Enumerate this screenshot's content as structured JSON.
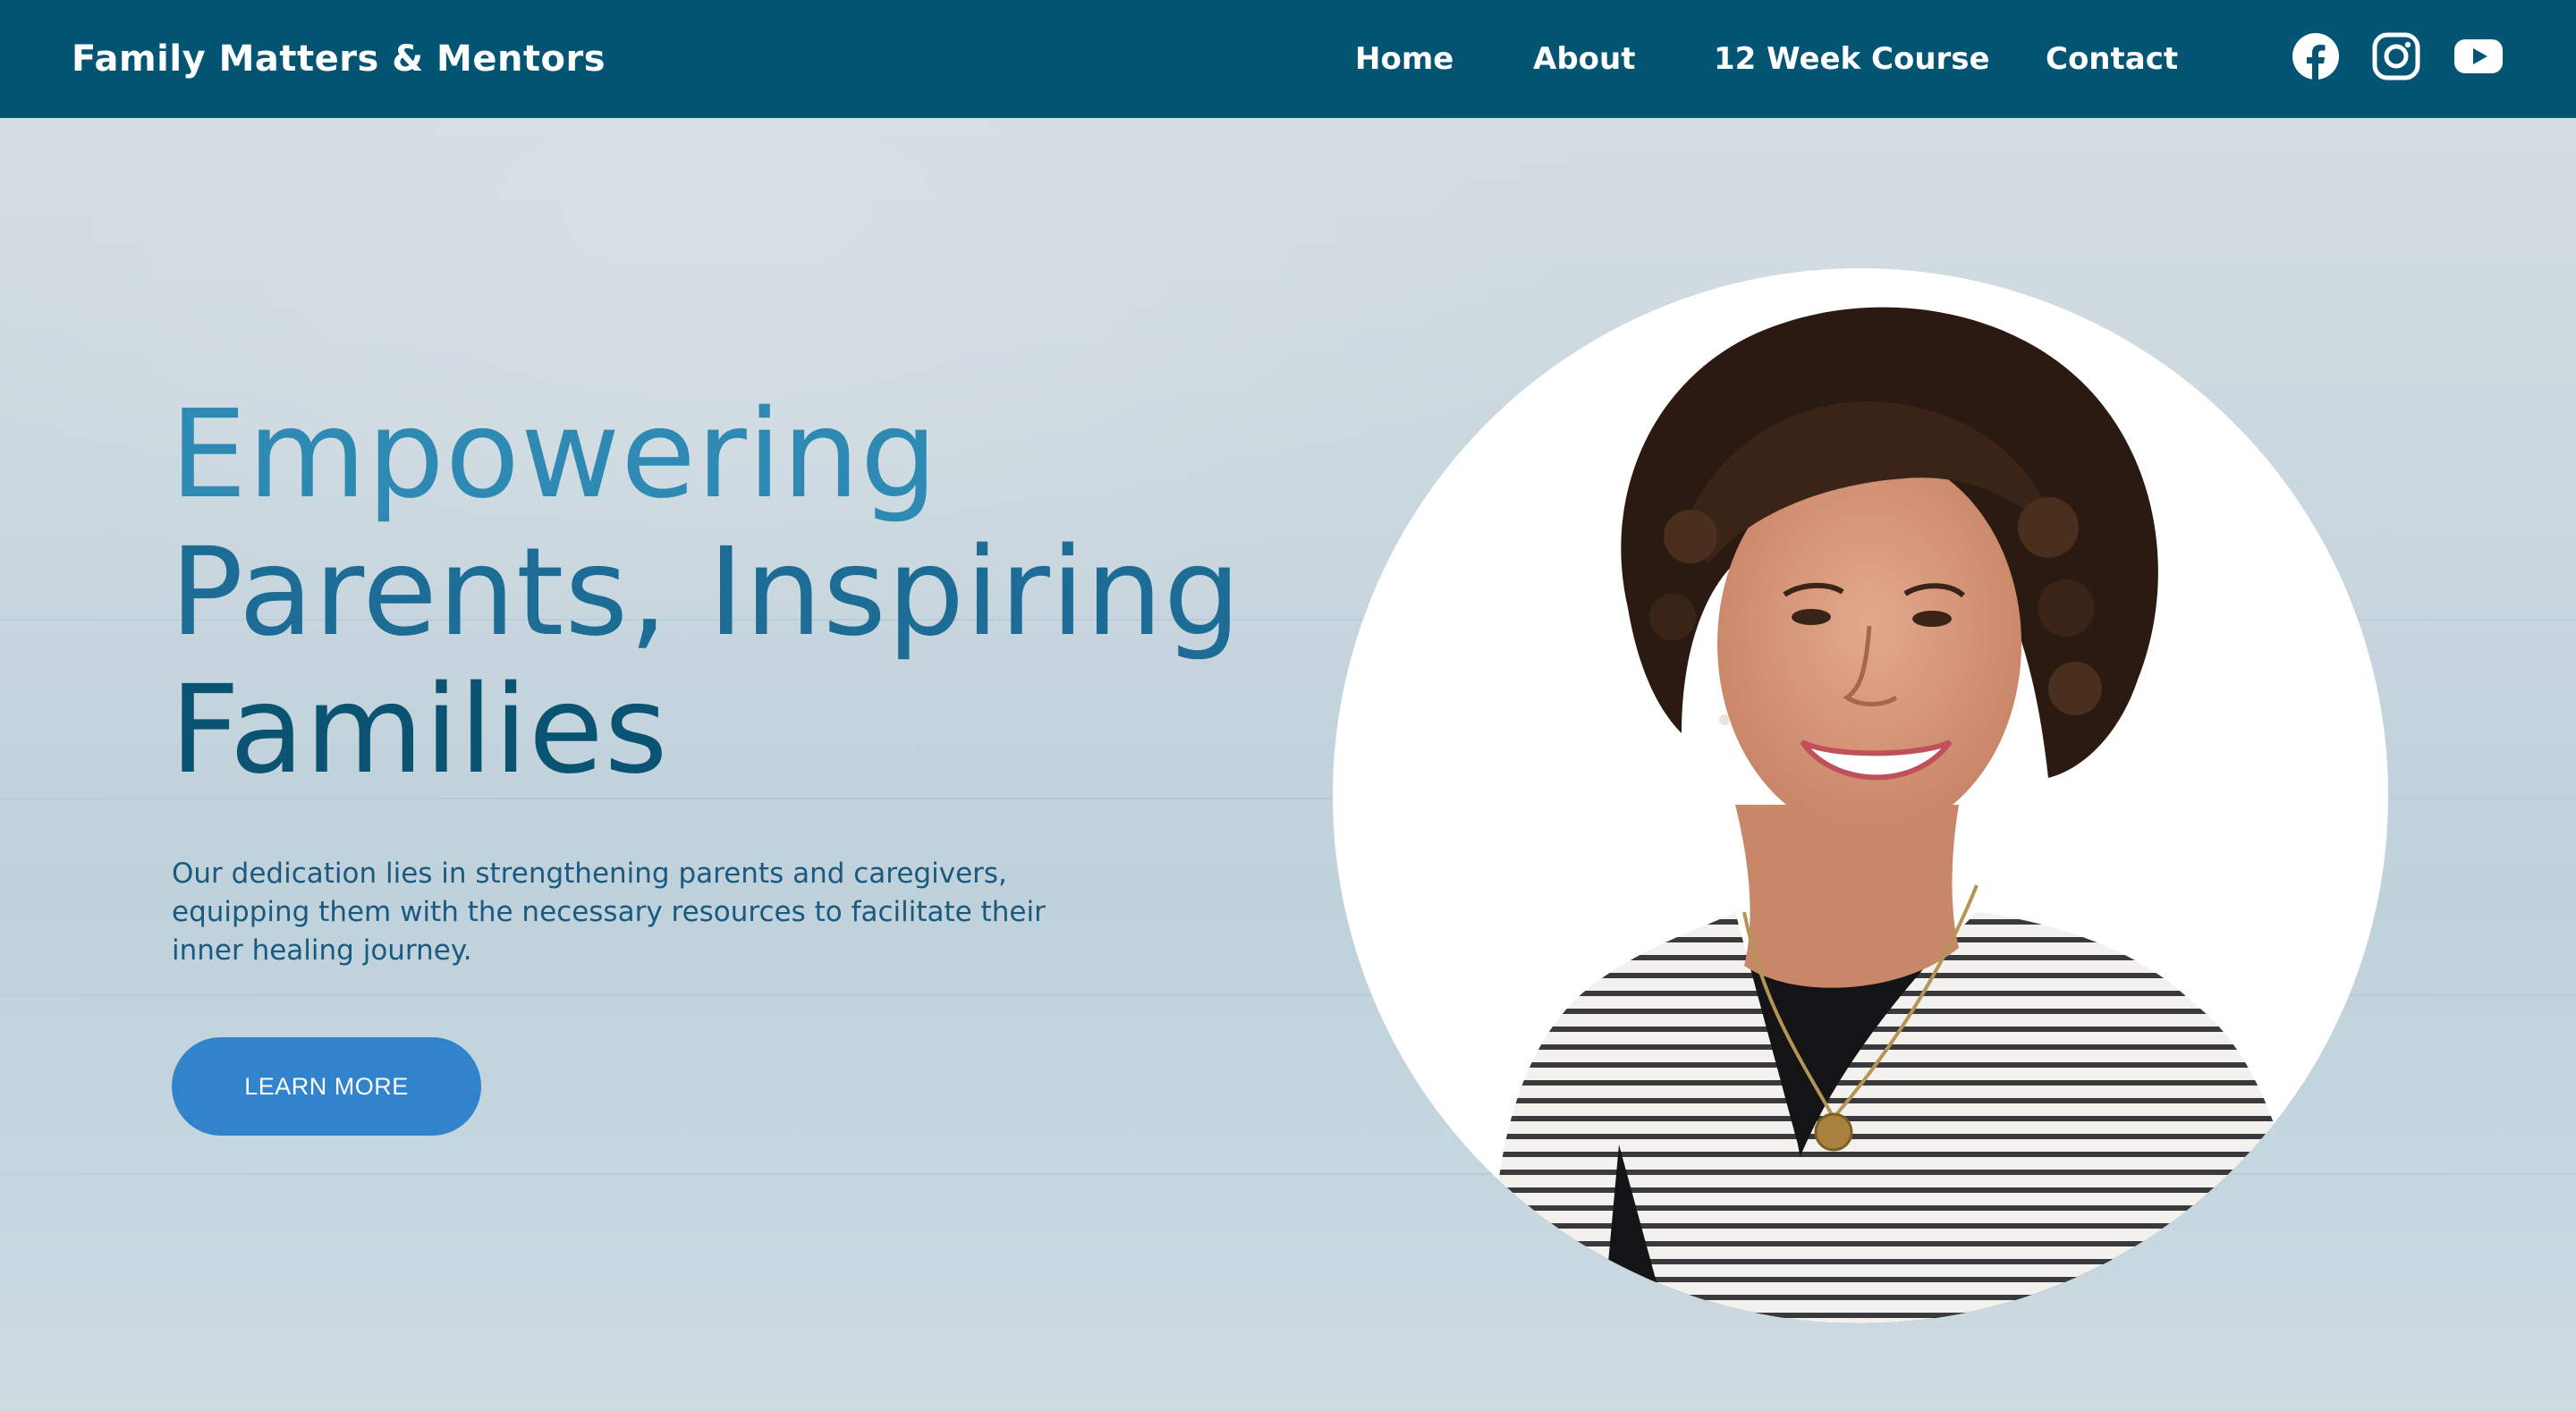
{
  "header": {
    "brand": "Family Matters & Mentors",
    "nav": [
      {
        "label": "Home"
      },
      {
        "label": "About"
      },
      {
        "label": "12 Week Course"
      },
      {
        "label": "Contact"
      }
    ],
    "social": [
      {
        "icon": "facebook-icon"
      },
      {
        "icon": "instagram-icon"
      },
      {
        "icon": "youtube-icon"
      }
    ]
  },
  "hero": {
    "headline": [
      "Empowering",
      "Parents, Inspiring",
      "Families"
    ],
    "subtext": "Our dedication lies in strengthening parents and caregivers, equipping them with the necessary resources to facilitate their inner healing journey.",
    "cta_label": "LEARN MORE",
    "portrait_icon": "portrait-photo"
  },
  "colors": {
    "header_bg": "#045574",
    "headline_top": "#2f8ab3",
    "headline_bottom": "#0b5372",
    "body_text": "#1a5a80",
    "cta_bg": "#3184cb"
  }
}
